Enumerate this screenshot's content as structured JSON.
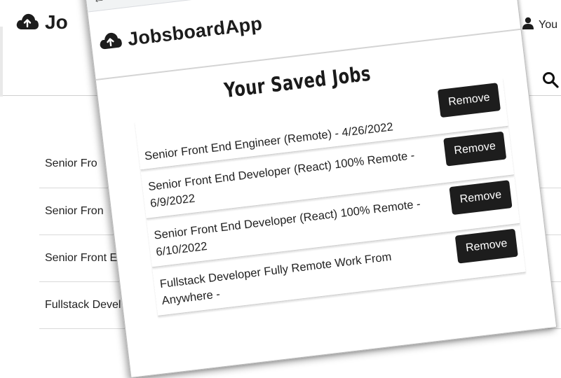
{
  "background": {
    "logo_text": "Jo",
    "user_label": "You",
    "jobs": [
      {
        "title": "Senior Fro"
      },
      {
        "title": "Senior Fron"
      },
      {
        "title": "Senior Front E"
      },
      {
        "title": "Fullstack Devel"
      }
    ]
  },
  "window": {
    "toolbar": {
      "back_icon": "arrow-left-icon",
      "forward_icon": "arrow-right-icon",
      "reload_icon": "reload-icon",
      "home_icon": "home-icon"
    },
    "app": {
      "name": "JobsboardApp",
      "logo_icon": "cloud-upload-icon"
    },
    "page_title": "Your Saved Jobs",
    "saved_jobs": [
      {
        "title": "Senior Front End Engineer (Remote) - 4/26/2022",
        "remove_label": "Remove"
      },
      {
        "title": "Senior Front End Developer (React) 100% Remote - 6/9/2022",
        "remove_label": "Remove"
      },
      {
        "title": "Senior Front End Developer (React) 100% Remote - 6/10/2022",
        "remove_label": "Remove"
      },
      {
        "title": "Fullstack Developer Fully Remote Work From Anywhere - ",
        "remove_label": "Remove"
      }
    ]
  }
}
